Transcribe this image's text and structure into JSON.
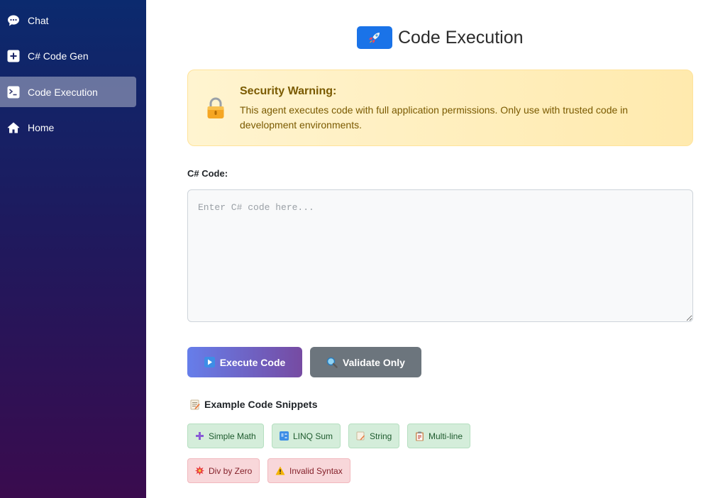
{
  "sidebar": {
    "items": [
      {
        "label": "Chat",
        "icon": "chat-bubble-icon"
      },
      {
        "label": "C# Code Gen",
        "icon": "plus-square-icon"
      },
      {
        "label": "Code Execution",
        "icon": "terminal-icon",
        "active": true
      },
      {
        "label": "Home",
        "icon": "home-icon"
      }
    ]
  },
  "header": {
    "title": "Code Execution",
    "icon": "rocket-icon"
  },
  "warning": {
    "icon": "lock-icon",
    "title": "Security Warning:",
    "body": "This agent executes code with full application permissions. Only use with trusted code in development environments."
  },
  "editor": {
    "label": "C# Code:",
    "placeholder": "Enter C# code here...",
    "value": ""
  },
  "actions": {
    "execute_label": "Execute Code",
    "execute_icon": "play-icon",
    "validate_label": "Validate Only",
    "validate_icon": "magnifier-icon"
  },
  "snippets": {
    "title": "Example Code Snippets",
    "icon": "memo-icon",
    "items": [
      {
        "label": "Simple Math",
        "icon": "plus-icon",
        "kind": "ok"
      },
      {
        "label": "LINQ Sum",
        "icon": "numbers-icon",
        "kind": "ok"
      },
      {
        "label": "String",
        "icon": "memo-icon",
        "kind": "ok"
      },
      {
        "label": "Multi-line",
        "icon": "clipboard-icon",
        "kind": "ok"
      },
      {
        "label": "Div by Zero",
        "icon": "explosion-icon",
        "kind": "error"
      },
      {
        "label": "Invalid Syntax",
        "icon": "warning-icon",
        "kind": "error"
      }
    ]
  },
  "colors": {
    "accent": "#1a73e8",
    "execute_gradient_start": "#667eea",
    "execute_gradient_end": "#764ba2",
    "validate": "#6c757d",
    "warning_text": "#7a5a00"
  }
}
